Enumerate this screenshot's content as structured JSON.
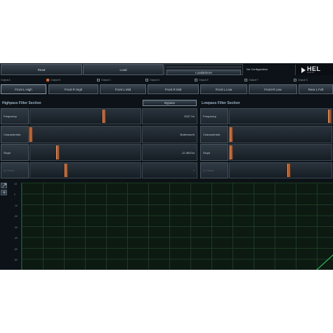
{
  "toolbar": {
    "read_label": "Read",
    "load_label": "Load",
    "load_store_label": "Load&Store",
    "config_text": "No Configuration",
    "logo_text": "HEL",
    "logo_sub": "AUDIO"
  },
  "outputs": [
    {
      "label": "Output A",
      "checked": false
    },
    {
      "label": "Output B",
      "checked": true
    },
    {
      "label": "Output C",
      "checked": false
    },
    {
      "label": "Output D",
      "checked": false
    },
    {
      "label": "Output E",
      "checked": false
    },
    {
      "label": "Output F",
      "checked": false
    },
    {
      "label": "Output G",
      "checked": false
    }
  ],
  "channels": [
    "Front L High",
    "Front R High",
    "Front L Mid",
    "Front R Mid",
    "Front L Low",
    "Front R Low",
    "Rear L Full"
  ],
  "highpass": {
    "title": "Highpass Filter Section",
    "bypass_label": "Bypass",
    "rows": [
      {
        "label": "Frequency",
        "value": "3337 Hz",
        "level": 0.67,
        "disabled": false
      },
      {
        "label": "Characteristic",
        "value": "Butterworth",
        "level": 0.01,
        "disabled": false
      },
      {
        "label": "Slope",
        "value": "-12 dB/Oct",
        "level": 0.25,
        "disabled": false
      },
      {
        "label": "Q-Factor",
        "value": "0",
        "level": 0.33,
        "disabled": true
      }
    ]
  },
  "lowpass": {
    "title": "Lowpass Filter Section",
    "rows": [
      {
        "label": "Frequency",
        "level": 0.98,
        "disabled": false
      },
      {
        "label": "Characteristic",
        "level": 0.02,
        "disabled": false
      },
      {
        "label": "Slope",
        "level": 0.02,
        "disabled": false
      },
      {
        "label": "Q-Factor",
        "level": 0.58,
        "disabled": true
      }
    ]
  },
  "graph": {
    "y_ticks": [
      "10",
      "0",
      "-10",
      "-20",
      "-30",
      "-40",
      "-50",
      "-60"
    ]
  },
  "colors": {
    "accent": "#d8622a",
    "background": "#0c1217",
    "grid": "#1d3a22",
    "curve": "#2fb85a"
  }
}
